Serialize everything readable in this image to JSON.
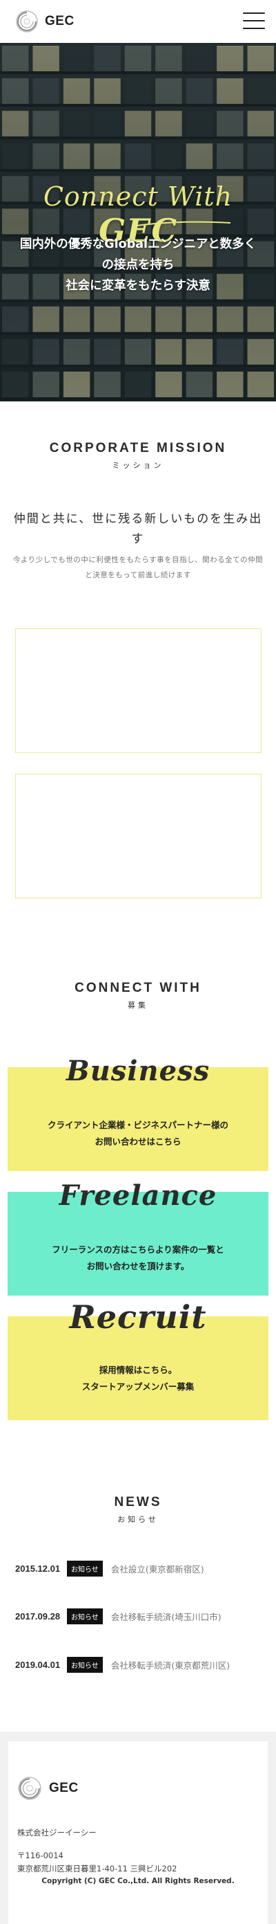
{
  "brand": {
    "name": "GEC"
  },
  "hero": {
    "title_prefix": "Connect With",
    "title_brand": "GEC",
    "copy_line1": "国内外の優秀なGlobalエンジニアと数多く",
    "copy_line2": "の接点を持ち",
    "copy_line3": "社会に変革をもたらす決意"
  },
  "mission": {
    "heading_en": "CORPORATE MISSION",
    "heading_jp": "ミッション",
    "lead": "仲間と共に、世に残る新しいものを生み出す",
    "sub": "今より少しでも世の中に利便性をもたらす事を目指し、関わる全ての仲間と決意をもって前進し続けます"
  },
  "connect": {
    "heading_en": "CONNECT WITH",
    "heading_jp": "募集",
    "cards": [
      {
        "script": "Business",
        "line1": "クライアント企業様・ビジネスパートナー様の",
        "line2": "お問い合わせはこちら",
        "color": "#f4ee7a"
      },
      {
        "script": "Freelance",
        "line1": "フリーランスの方はこちらより案件の一覧と",
        "line2": "お問い合わせを頂けます。",
        "color": "#6dedcc"
      },
      {
        "script": "Recruit",
        "line1": "採用情報はこちら。",
        "line2": "スタートアップメンバー募集",
        "color": "#f4ee7a"
      }
    ]
  },
  "news": {
    "heading_en": "NEWS",
    "heading_jp": "お知らせ",
    "items": [
      {
        "date": "2015.12.01",
        "tag": "お知らせ",
        "title": "会社設立(東京都新宿区)"
      },
      {
        "date": "2017.09.28",
        "tag": "お知らせ",
        "title": "会社移転手続済(埼玉川口市)"
      },
      {
        "date": "2019.04.01",
        "tag": "お知らせ",
        "title": "会社移転手続済(東京都荒川区)"
      }
    ]
  },
  "footer": {
    "company": "株式会社ジーイーシー",
    "postal": "〒116-0014",
    "address": "東京都荒川区東日暮里1-40-11 三興ビル202",
    "copyright": "Copyright (C) GEC Co.,Ltd. All Rights Reserved."
  },
  "colors": {
    "accent_yellow": "#f4ee7a",
    "accent_mint": "#6dedcc",
    "hero_title": "#e7e77e"
  }
}
